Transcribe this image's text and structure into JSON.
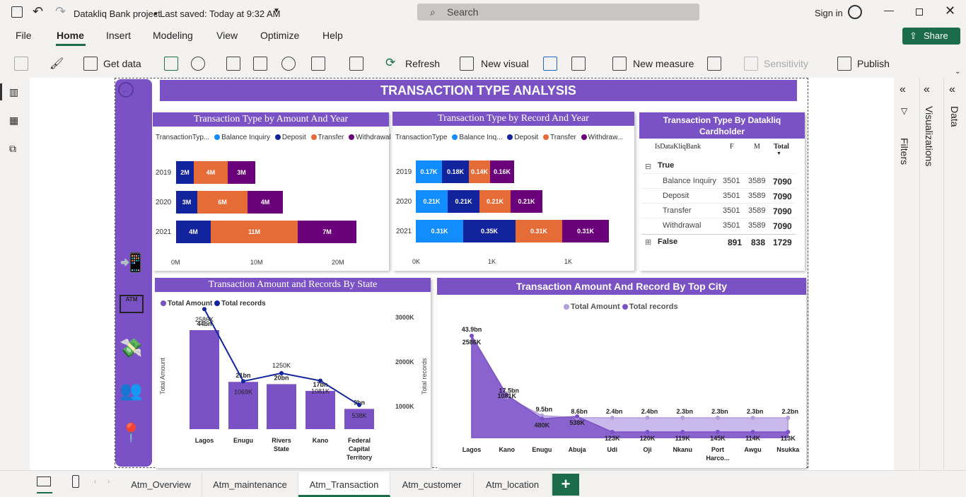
{
  "app": {
    "title": "Datakliq Bank project",
    "saved": "• Last saved: Today at 9:32 AM",
    "search": "Search",
    "signin": "Sign in",
    "share": "Share"
  },
  "menu": [
    "File",
    "Home",
    "Insert",
    "Modeling",
    "View",
    "Optimize",
    "Help"
  ],
  "ribbon": {
    "getdata": "Get data",
    "refresh": "Refresh",
    "newvisual": "New visual",
    "newmeasure": "New measure",
    "sensitivity": "Sensitivity",
    "publish": "Publish"
  },
  "report": {
    "title": "TRANSACTION TYPE ANALYSIS"
  },
  "chart1": {
    "title": "Transaction Type by Amount And Year",
    "legend_title": "TransactionTyp...",
    "legend": [
      "Balance Inquiry",
      "Deposit",
      "Transfer",
      "Withdrawal"
    ],
    "years": [
      "2019",
      "2020",
      "2021"
    ],
    "xticks": [
      "0M",
      "10M",
      "20M"
    ],
    "rows": [
      {
        "year": "2019",
        "deposit": "2M",
        "transfer": "4M",
        "withdrawal": "3M"
      },
      {
        "year": "2020",
        "deposit": "3M",
        "transfer": "6M",
        "withdrawal": "4M"
      },
      {
        "year": "2021",
        "deposit": "4M",
        "transfer": "11M",
        "withdrawal": "7M"
      }
    ]
  },
  "chart2": {
    "title": "Transaction Type by Record And Year",
    "legend_title": "TransactionType",
    "legend": [
      "Balance Inq...",
      "Deposit",
      "Transfer",
      "Withdraw..."
    ],
    "years": [
      "2019",
      "2020",
      "2021"
    ],
    "xticks": [
      "0K",
      "1K",
      "1K"
    ],
    "rows": [
      [
        "0.17K",
        "0.18K",
        "0.14K",
        "0.16K"
      ],
      [
        "0.21K",
        "0.21K",
        "0.21K",
        "0.21K"
      ],
      [
        "0.31K",
        "0.35K",
        "0.31K",
        "0.31K"
      ]
    ]
  },
  "matrix": {
    "title": "Transaction Type By Datakliq Cardholder",
    "headers": [
      "IsDataKliqBank",
      "F",
      "M",
      "Total"
    ],
    "true_label": "True",
    "false_label": "False",
    "rows": [
      [
        "Balance Inquiry",
        "3501",
        "3589",
        "7090"
      ],
      [
        "Deposit",
        "3501",
        "3589",
        "7090"
      ],
      [
        "Transfer",
        "3501",
        "3589",
        "7090"
      ],
      [
        "Withdrawal",
        "3501",
        "3589",
        "7090"
      ]
    ],
    "false_row": [
      "891",
      "838",
      "1729"
    ]
  },
  "chart_data": [
    {
      "type": "bar",
      "title": "Transaction Type by Amount And Year",
      "categories": [
        "2019",
        "2020",
        "2021"
      ],
      "series": [
        {
          "name": "Deposit",
          "values": [
            2,
            3,
            4
          ]
        },
        {
          "name": "Transfer",
          "values": [
            4,
            6,
            11
          ]
        },
        {
          "name": "Withdrawal",
          "values": [
            3,
            4,
            7
          ]
        }
      ]
    },
    {
      "type": "bar",
      "title": "Transaction Type by Record And Year",
      "categories": [
        "2019",
        "2020",
        "2021"
      ],
      "series": [
        {
          "name": "Balance Inquiry",
          "values": [
            0.17,
            0.21,
            0.31
          ]
        },
        {
          "name": "Deposit",
          "values": [
            0.18,
            0.21,
            0.35
          ]
        },
        {
          "name": "Transfer",
          "values": [
            0.14,
            0.21,
            0.31
          ]
        },
        {
          "name": "Withdrawal",
          "values": [
            0.16,
            0.21,
            0.31
          ]
        }
      ]
    },
    {
      "type": "bar",
      "title": "Transaction Amount and Records By State",
      "categories": [
        "Lagos",
        "Enugu",
        "Rivers State",
        "Kano",
        "Federal Capital Territory"
      ],
      "cat_lines": [
        [
          "Lagos"
        ],
        [
          "Enugu"
        ],
        [
          "Rivers",
          "State"
        ],
        [
          "Kano"
        ],
        [
          "Federal",
          "Capital",
          "Territory"
        ]
      ],
      "amount_labels": [
        "44bn",
        "21bn",
        "20bn",
        "17bn",
        "9bn"
      ],
      "amount_values": [
        44,
        21,
        20,
        17,
        9
      ],
      "record_labels": [
        "2586K",
        "1069K",
        "1250K",
        "1081K",
        "538K"
      ],
      "record_values": [
        2586,
        1069,
        1250,
        1081,
        538
      ],
      "legend": [
        "Total Amount",
        "Total records"
      ],
      "ylabel": "Total Amount",
      "y2label": "Total records",
      "y2ticks": [
        "3000K",
        "2000K",
        "1000K"
      ]
    },
    {
      "type": "area",
      "title": "Transaction Amount And Record By Top City",
      "categories": [
        "Lagos",
        "Kano",
        "Enugu",
        "Abuja",
        "Udi",
        "Oji",
        "Nkanu",
        "Port Harco...",
        "Awgu",
        "Nsukka"
      ],
      "cat_lines": [
        [
          "Lagos"
        ],
        [
          "Kano"
        ],
        [
          "Enugu"
        ],
        [
          "Abuja"
        ],
        [
          "Udi"
        ],
        [
          "Oji"
        ],
        [
          "Nkanu"
        ],
        [
          "Port",
          "Harco..."
        ],
        [
          "Awgu"
        ],
        [
          "Nsukka"
        ]
      ],
      "amount_labels": [
        "43.9bn",
        "17.5bn",
        "9.5bn",
        "8.6bn",
        "2.4bn",
        "2.4bn",
        "2.3bn",
        "2.3bn",
        "2.3bn",
        "2.2bn"
      ],
      "amount_values": [
        43.9,
        17.5,
        9.5,
        8.6,
        2.4,
        2.4,
        2.3,
        2.3,
        2.3,
        2.2
      ],
      "record_labels": [
        "2586K",
        "1081K",
        "480K",
        "538K",
        "123K",
        "120K",
        "119K",
        "145K",
        "114K",
        "113K"
      ],
      "record_values": [
        2586,
        1081,
        480,
        538,
        123,
        120,
        119,
        145,
        114,
        113
      ],
      "legend": [
        "Total Amount",
        "Total records"
      ]
    }
  ],
  "chart3_title": "Transaction Amount and Records By State",
  "chart4_title": "Transaction Amount And Record By Top City",
  "panes": {
    "filters": "Filters",
    "visualizations": "Visualizations",
    "data": "Data"
  },
  "tabs": [
    "Atm_Overview",
    "Atm_maintenance",
    "Atm_Transaction",
    "Atm_customer",
    "Atm_location"
  ],
  "colors": {
    "purple": "#7b52c6",
    "balance": "#118dff",
    "deposit": "#12239e",
    "transfer": "#e66c37",
    "withdrawal": "#6b007b"
  }
}
